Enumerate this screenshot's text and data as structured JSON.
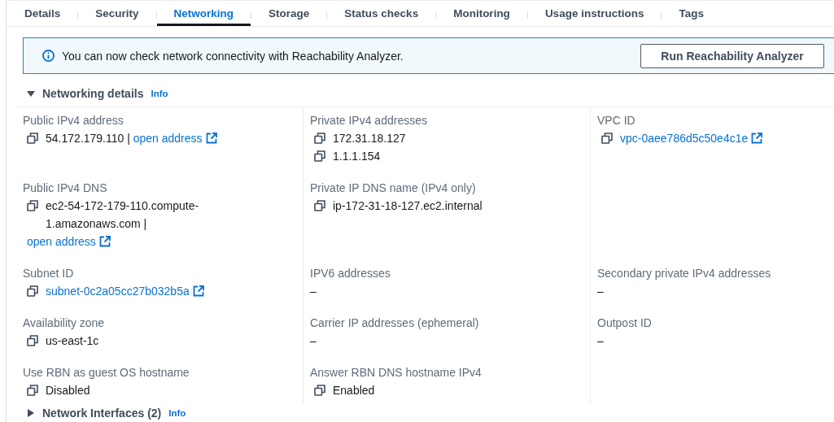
{
  "tabs": [
    {
      "label": "Details",
      "selected": false
    },
    {
      "label": "Security",
      "selected": false
    },
    {
      "label": "Networking",
      "selected": true
    },
    {
      "label": "Storage",
      "selected": false
    },
    {
      "label": "Status checks",
      "selected": false
    },
    {
      "label": "Monitoring",
      "selected": false
    },
    {
      "label": "Usage instructions",
      "selected": false
    },
    {
      "label": "Tags",
      "selected": false
    }
  ],
  "alert": {
    "text": "You can now check network connectivity with Reachability Analyzer.",
    "button": "Run Reachability Analyzer"
  },
  "sections": [
    {
      "title": "Networking details",
      "info": "Info",
      "expanded": true,
      "rows": [
        [
          {
            "label": "Public IPv4 address",
            "values": [
              {
                "copyable": true,
                "text": "54.172.179.110 |",
                "link": "open address",
                "external": true
              }
            ]
          },
          {
            "label": "Private IPv4 addresses",
            "values": [
              {
                "copyable": true,
                "text": "172.31.18.127"
              },
              {
                "copyable": true,
                "text": "1.1.1.154"
              }
            ]
          },
          {
            "label": "VPC ID",
            "values": [
              {
                "copyable": true,
                "link": "vpc-0aee786d5c50e4c1e",
                "external": true
              }
            ]
          }
        ],
        [
          {
            "label": "Public IPv4 DNS",
            "values": [
              {
                "copyable": true,
                "text": "ec2-54-172-179-110.compute-1.amazonaws.com |",
                "link": "open address",
                "external": true
              }
            ]
          },
          {
            "label": "Private IP DNS name (IPv4 only)",
            "values": [
              {
                "copyable": true,
                "text": "ip-172-31-18-127.ec2.internal"
              }
            ]
          }
        ],
        [
          {
            "label": "Subnet ID",
            "values": [
              {
                "copyable": true,
                "link": "subnet-0c2a05cc27b032b5a",
                "external": true
              }
            ]
          },
          {
            "label": "IPV6 addresses",
            "values": [
              {
                "copyable": false,
                "text": "–"
              }
            ]
          },
          {
            "label": "Secondary private IPv4 addresses",
            "values": [
              {
                "copyable": false,
                "text": "–"
              }
            ]
          }
        ],
        [
          {
            "label": "Availability zone",
            "values": [
              {
                "copyable": true,
                "text": "us-east-1c"
              }
            ]
          },
          {
            "label": "Carrier IP addresses (ephemeral)",
            "values": [
              {
                "copyable": false,
                "text": "–"
              }
            ]
          },
          {
            "label": "Outpost ID",
            "values": [
              {
                "copyable": false,
                "text": "–"
              }
            ]
          }
        ],
        [
          {
            "label": "Use RBN as guest OS hostname",
            "values": [
              {
                "copyable": true,
                "text": "Disabled"
              }
            ]
          },
          {
            "label": "Answer RBN DNS hostname IPv4",
            "values": [
              {
                "copyable": true,
                "text": "Enabled"
              }
            ]
          }
        ]
      ]
    },
    {
      "title": "Network Interfaces (2)",
      "info": "Info",
      "expanded": false
    }
  ]
}
